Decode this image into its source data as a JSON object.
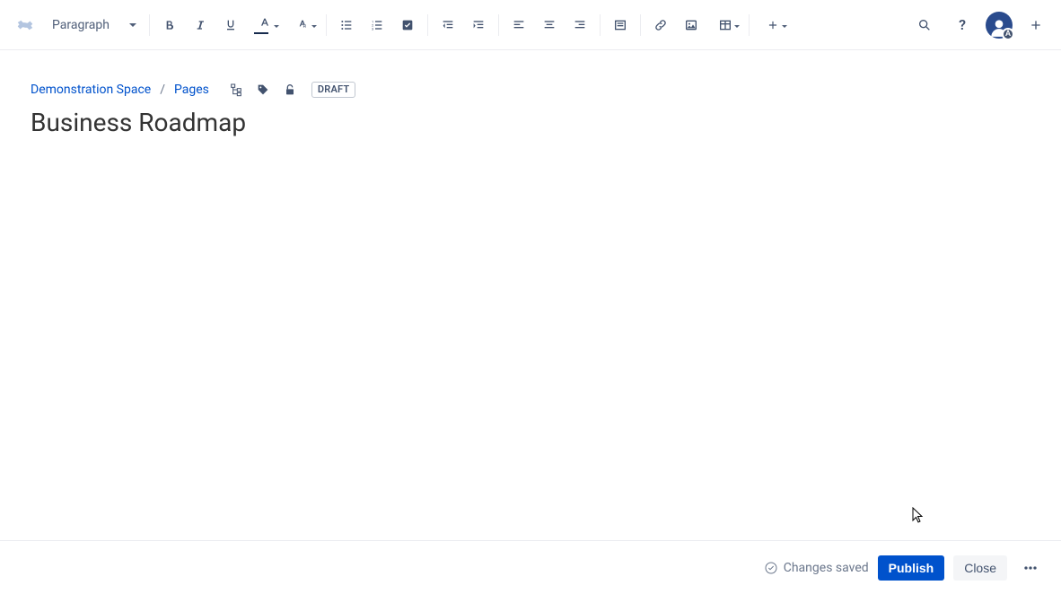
{
  "toolbar": {
    "paragraph_selector": "Paragraph"
  },
  "breadcrumb": {
    "space": "Demonstration Space",
    "pages": "Pages",
    "draft_label": "DRAFT"
  },
  "page": {
    "title": "Business Roadmap"
  },
  "footer": {
    "status": "Changes saved",
    "publish": "Publish",
    "close": "Close"
  },
  "avatar": {
    "badge": "A"
  }
}
